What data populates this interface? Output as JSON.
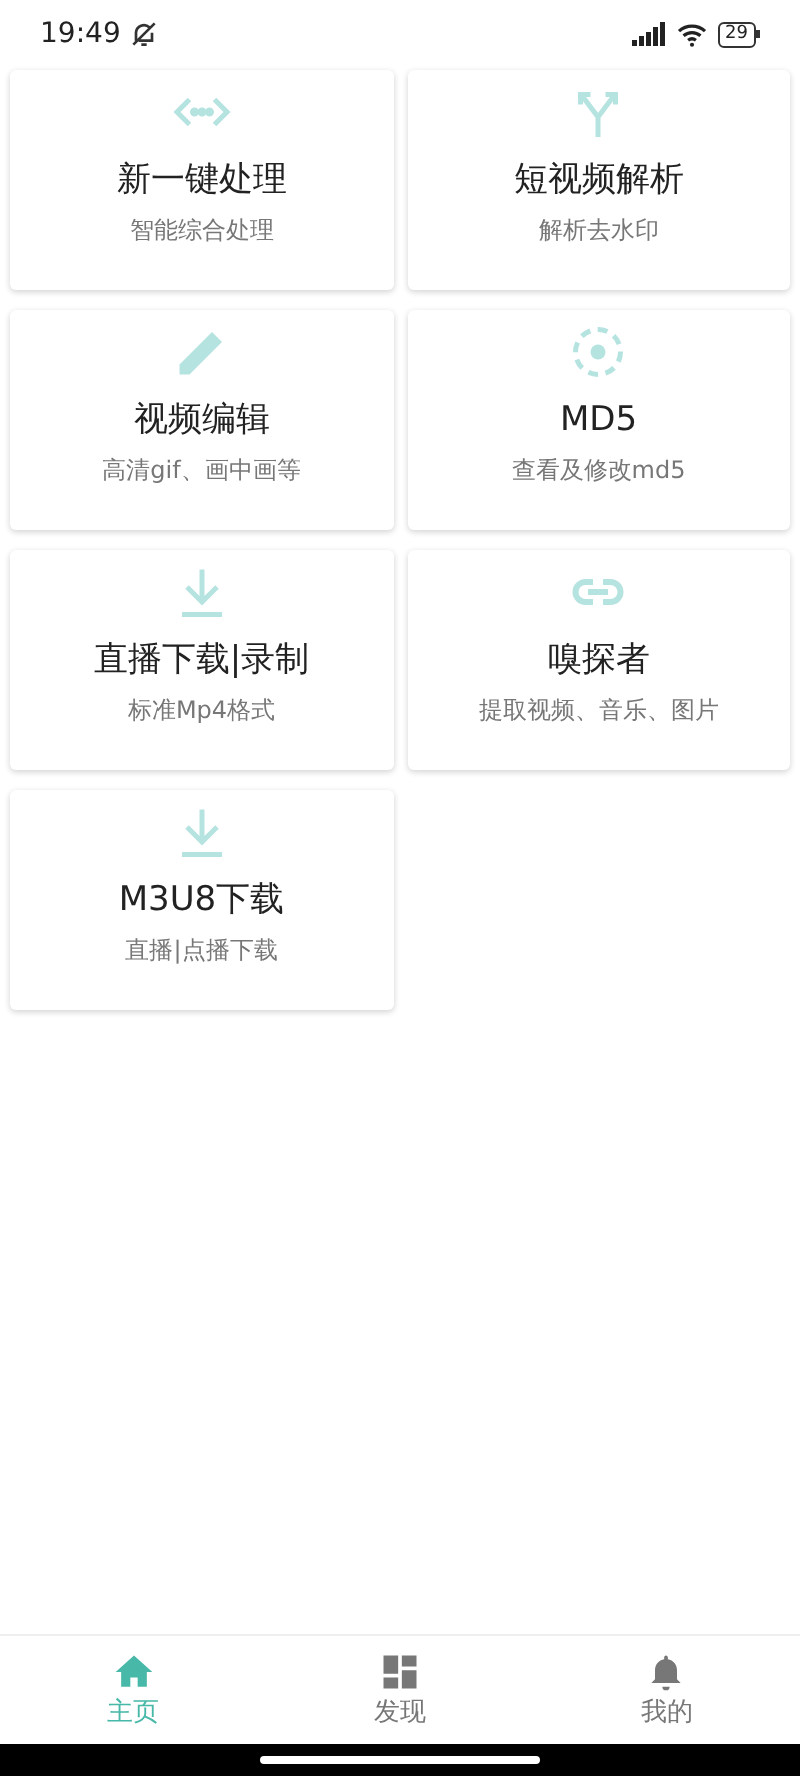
{
  "status_bar": {
    "time": "19:49",
    "battery": "29"
  },
  "cards": [
    {
      "kind": "code",
      "title": "新一键处理",
      "subtitle": "智能综合处理"
    },
    {
      "kind": "fork",
      "title": "短视频解析",
      "subtitle": "解析去水印"
    },
    {
      "kind": "pencil",
      "title": "视频编辑",
      "subtitle": "高清gif、画中画等"
    },
    {
      "kind": "target",
      "title": "MD5",
      "subtitle": "查看及修改md5"
    },
    {
      "kind": "download",
      "title": "直播下载|录制",
      "subtitle": "标准Mp4格式"
    },
    {
      "kind": "link",
      "title": "嗅探者",
      "subtitle": "提取视频、音乐、图片"
    },
    {
      "kind": "download",
      "title": "M3U8下载",
      "subtitle": "直播|点播下载"
    }
  ],
  "nav": [
    {
      "kind": "home",
      "label": "主页",
      "selected": true
    },
    {
      "kind": "grid",
      "label": "发现",
      "selected": false
    },
    {
      "kind": "bell",
      "label": "我的",
      "selected": false
    }
  ]
}
